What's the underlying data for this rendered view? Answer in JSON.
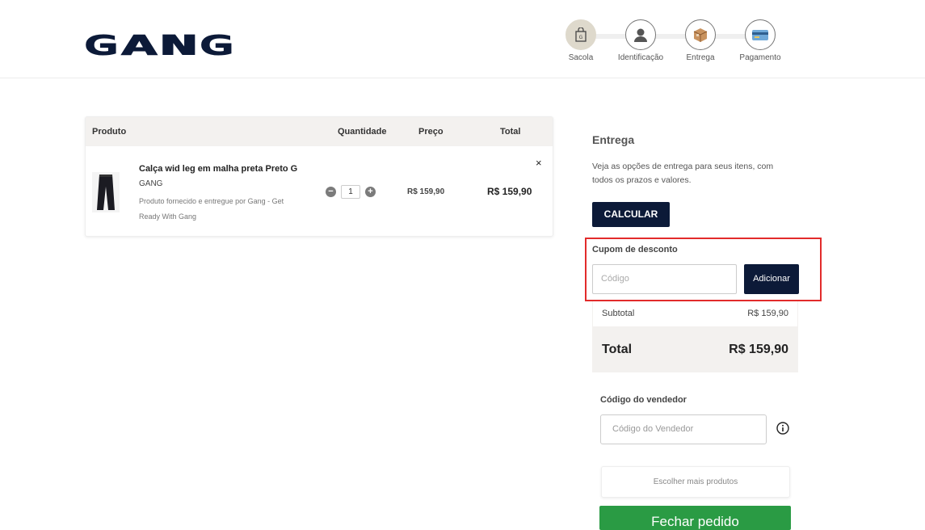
{
  "brand": {
    "logo_text": "GANG"
  },
  "steps": [
    {
      "label": "Sacola",
      "icon": "bag-icon"
    },
    {
      "label": "Identificação",
      "icon": "user-icon"
    },
    {
      "label": "Entrega",
      "icon": "box-icon"
    },
    {
      "label": "Pagamento",
      "icon": "card-icon"
    }
  ],
  "cart": {
    "headers": {
      "product": "Produto",
      "quantity": "Quantidade",
      "price": "Preço",
      "total": "Total"
    },
    "item": {
      "name": "Calça wid leg em malha preta Preto G",
      "brand": "GANG",
      "note": "Produto fornecido e entregue por Gang - Get Ready With Gang",
      "quantity": "1",
      "minus": "−",
      "plus": "+",
      "price": "R$ 159,90",
      "total": "R$ 159,90",
      "remove": "×"
    }
  },
  "delivery": {
    "title": "Entrega",
    "description": "Veja as opções de entrega para seus itens, com todos os prazos e valores.",
    "calc_label": "CALCULAR"
  },
  "coupon": {
    "title": "Cupom de desconto",
    "placeholder": "Código",
    "add_label": "Adicionar"
  },
  "summary": {
    "subtotal_label": "Subtotal",
    "subtotal_value": "R$ 159,90",
    "total_label": "Total",
    "total_value": "R$ 159,90"
  },
  "seller": {
    "title": "Código do vendedor",
    "placeholder": "Código do Vendedor"
  },
  "actions": {
    "more_products": "Escolher mais produtos",
    "close_order": "Fechar pedido"
  },
  "colors": {
    "navy": "#0c1a38",
    "highlight": "#e22b2b",
    "green": "#2a9b44"
  }
}
